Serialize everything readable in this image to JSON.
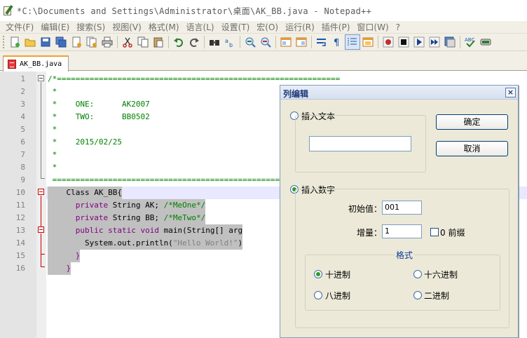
{
  "window": {
    "title": "*C:\\Documents and Settings\\Administrator\\桌面\\AK_BB.java - Notepad++"
  },
  "menu": [
    "文件(F)",
    "编辑(E)",
    "搜索(S)",
    "视图(V)",
    "格式(M)",
    "语言(L)",
    "设置(T)",
    "宏(O)",
    "运行(R)",
    "插件(P)",
    "窗口(W)",
    "?"
  ],
  "toolbar": {
    "icons": [
      "new-file-icon",
      "open-file-icon",
      "save-icon",
      "save-all-icon",
      "close-icon",
      "close-all-icon",
      "print-icon",
      "cut-icon",
      "copy-icon",
      "paste-icon",
      "undo-icon",
      "redo-icon",
      "find-icon",
      "replace-icon",
      "zoom-in-icon",
      "zoom-out-icon",
      "sync-vertical-icon",
      "sync-horizontal-icon",
      "word-wrap-icon",
      "show-all-chars-icon",
      "indent-guide-icon",
      "user-language-icon",
      "record-macro-icon",
      "stop-record-icon",
      "playback-macro-icon",
      "run-macro-multiple-icon",
      "save-macro-icon",
      "spellcheck-icon",
      "plugin-icon"
    ]
  },
  "tab": {
    "label": "AK_BB.java"
  },
  "editor": {
    "line_numbers": [
      "1",
      "2",
      "3",
      "4",
      "5",
      "6",
      "7",
      "8",
      "9",
      "10",
      "11",
      "12",
      "13",
      "14",
      "15",
      "16"
    ],
    "lines": [
      "/*=============================================================",
      " *",
      " *    ONE:      AK2007",
      " *    TWO:      BB0502",
      " *",
      " *    2015/02/25",
      " *",
      " *",
      " ==============================================================",
      "    Class AK_BB{",
      "      private String AK; /*MeOne*/",
      "      private String BB; /*MeTwo*/",
      "      public static void main(String[] args){",
      "        System.out.println(\"Hello World!\");",
      "      }",
      "    }"
    ],
    "line13_visible": "      public static void main(String[] arg",
    "line14_visible_pre": "        System.out.println(",
    "line14_visible_str": "\"Hello World!\"",
    "line14_visible_post": ")"
  },
  "dialog": {
    "title": "列编辑",
    "close": "×",
    "insert_text_label": "插入文本",
    "insert_text_value": "",
    "ok_label": "确定",
    "cancel_label": "取消",
    "insert_number_label": "插入数字",
    "initial_label": "初始值：",
    "initial_value": "001",
    "increment_label": "增量：",
    "increment_value": "1",
    "leading_zero_label": "0 前缀",
    "format_label": "格式",
    "formats": {
      "decimal": "十进制",
      "hex": "十六进制",
      "octal": "八进制",
      "binary": "二进制"
    },
    "selected_mode": "insert_number",
    "selected_format": "decimal"
  },
  "colors": {
    "comment": "#008000",
    "keyword": "#7f007f",
    "string": "#808080",
    "selection": "#c0c0c0",
    "current_line": "#e8e8ff"
  }
}
